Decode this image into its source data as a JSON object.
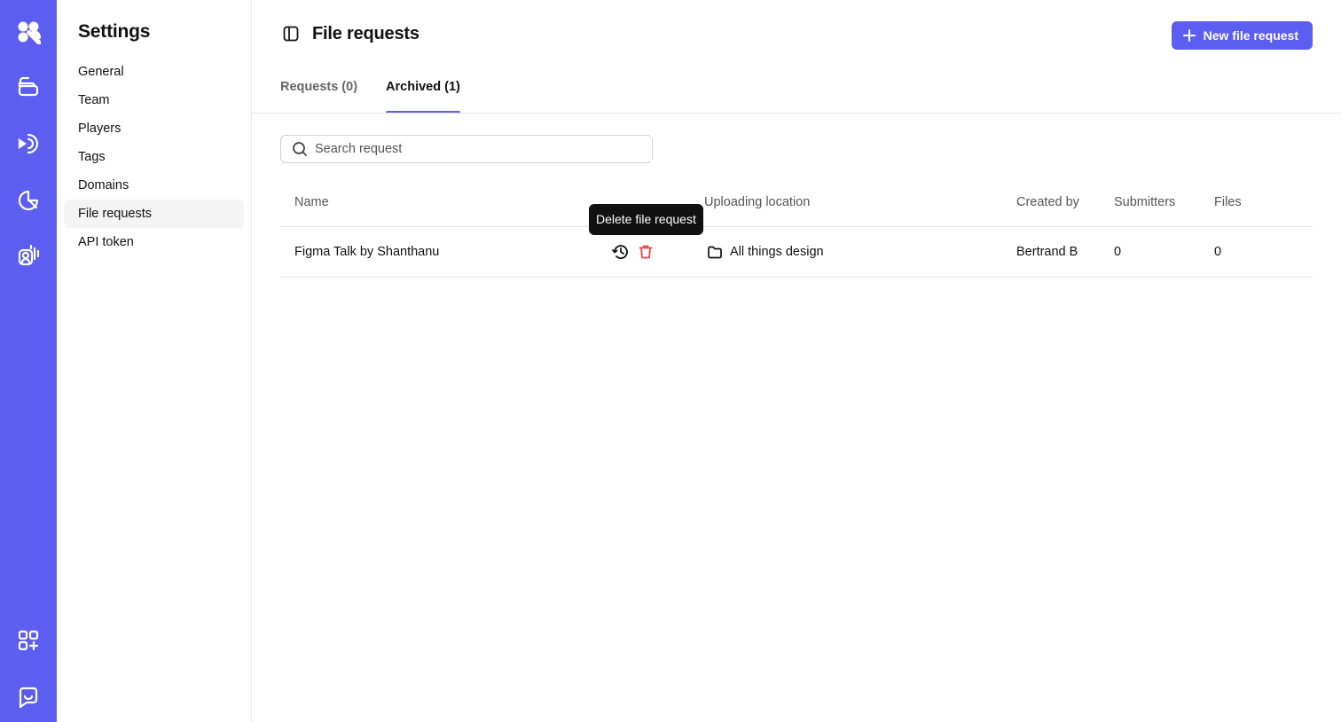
{
  "rail": {
    "icons": [
      "app-logo",
      "library-icon",
      "broadcast-icon",
      "analytics-icon",
      "audience-icon",
      "apps-add-icon",
      "chat-icon"
    ]
  },
  "settings": {
    "title": "Settings",
    "nav": [
      {
        "label": "General"
      },
      {
        "label": "Team"
      },
      {
        "label": "Players"
      },
      {
        "label": "Tags"
      },
      {
        "label": "Domains"
      },
      {
        "label": "File requests",
        "active": true
      },
      {
        "label": "API token"
      }
    ]
  },
  "header": {
    "title": "File requests",
    "new_button_label": "New file request"
  },
  "tabs": [
    {
      "label": "Requests (0)"
    },
    {
      "label": "Archived (1)",
      "active": true
    }
  ],
  "search": {
    "placeholder": "Search request",
    "value": ""
  },
  "table": {
    "columns": {
      "name": "Name",
      "location": "Uploading location",
      "created_by": "Created by",
      "submitters": "Submitters",
      "files": "Files"
    },
    "rows": [
      {
        "name": "Figma Talk by Shanthanu",
        "location": "All things design",
        "created_by": "Bertrand B",
        "submitters": "0",
        "files": "0"
      }
    ]
  },
  "tooltip": {
    "text": "Delete file request"
  },
  "colors": {
    "accent": "#5b5ef0",
    "danger": "#e5484d"
  }
}
